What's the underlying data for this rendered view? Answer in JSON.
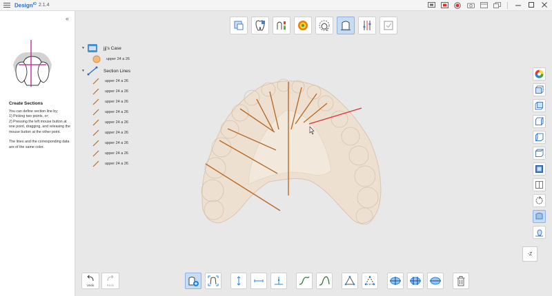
{
  "titlebar": {
    "app_name": "Design",
    "app_sup": "iO",
    "version": "2.1.4"
  },
  "left_panel": {
    "collapse_icon": "«",
    "section_title": "Create Sections",
    "description": "You can define section line by;\n1) Picking two points, or;\n2) Pressing the left mouse button at one point, dragging, and releasing the mouse button at the other point.\n\nThe lines and the corresponding data are of the same color."
  },
  "tree": {
    "case_label": "jjj's Case",
    "model_label": "upper 24  a 26",
    "section_group_label": "Section Lines",
    "section_lines": [
      "upper 24  a 26",
      "upper 24  a 26",
      "upper 24  a 26",
      "upper 24  a 26",
      "upper 24  a 26",
      "upper 24  a 26",
      "upper 24  a 26",
      "upper 24  a 26",
      "upper 24  a 26"
    ]
  },
  "view": {
    "axis_label": "-Z"
  },
  "bottom": {
    "undo_label": "Undo",
    "redo_label": "Redo"
  },
  "colors": {
    "accent": "#2a6fc9",
    "section_line": "#b86a28",
    "active_line": "#e03030",
    "model": "#ede0d0"
  }
}
